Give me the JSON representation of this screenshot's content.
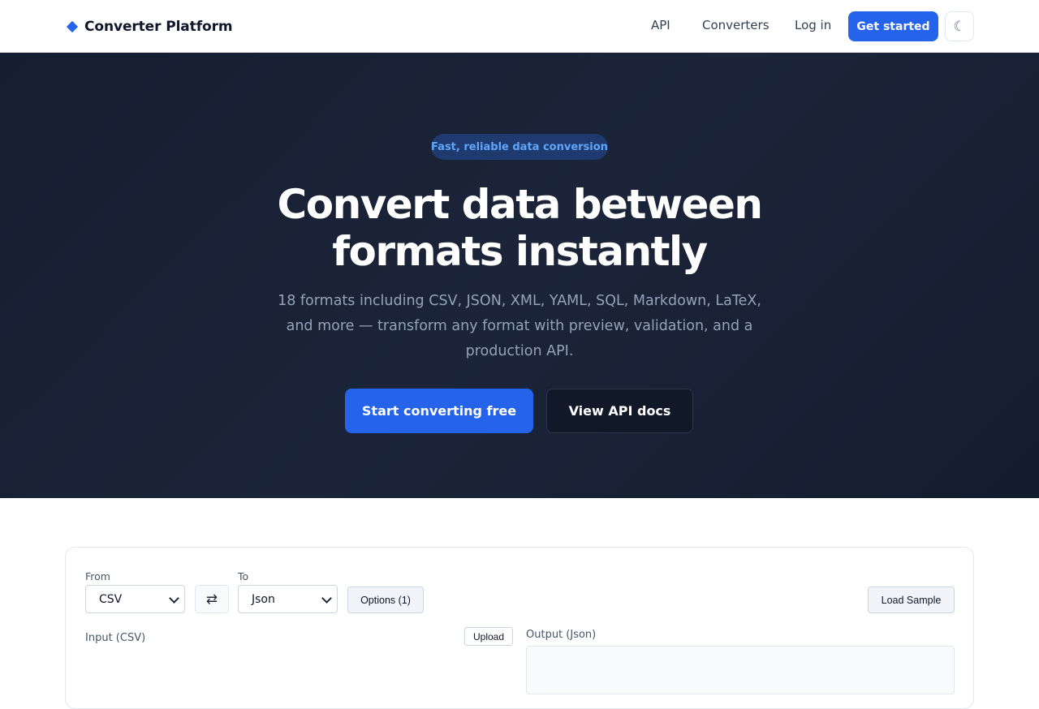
{
  "header": {
    "brand": "Converter Platform",
    "brand_icon": "diamond-icon",
    "nav": {
      "api": "API",
      "converters": "Converters",
      "login": "Log in"
    },
    "get_started": "Get started",
    "theme_toggle_icon": "moon-icon",
    "theme_toggle_glyph": "☾"
  },
  "hero": {
    "badge": "Fast, reliable data conversion",
    "title_line1": "Convert data between",
    "title_line2": "formats instantly",
    "subtitle": "18 formats including CSV, JSON, XML, YAML, SQL, Markdown, LaTeX, and more — transform any format with preview, validation, and a production API.",
    "primary_cta": "Start converting free",
    "secondary_cta": "View API docs"
  },
  "converter": {
    "from_label": "From",
    "from_value": "CSV",
    "to_label": "To",
    "to_value": "Json",
    "swap_glyph": "⇄",
    "options_label": "Options (1)",
    "load_sample_label": "Load Sample",
    "input_label": "Input (CSV)",
    "upload_label": "Upload",
    "output_label": "Output (Json)"
  },
  "colors": {
    "accent": "#2563eb",
    "hero_bg": "#1b2438",
    "badge_text": "#60a5fa"
  }
}
